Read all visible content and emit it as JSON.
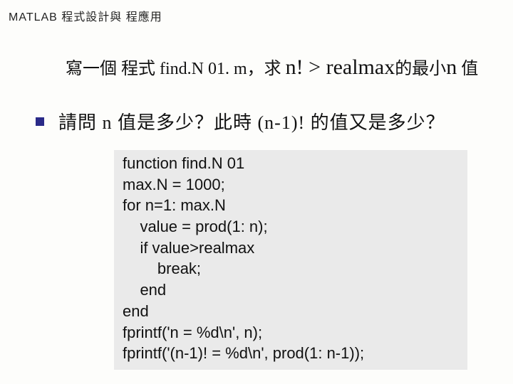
{
  "header": "MATLAB 程式設計與 程應用",
  "line1": {
    "p1": "寫一個 程式 find.N 01. m，求 ",
    "big1": "n! > realmax",
    "p2": "的最小",
    "big2": "n",
    "p3": " 值"
  },
  "line2": "請問 n 值是多少？此時 (n-1)! 的值又是多少？",
  "code": "function find.N 01\nmax.N = 1000;\nfor n=1: max.N\n    value = prod(1: n);\n    if value>realmax\n        break;\n    end\nend\nfprintf('n = %d\\n', n);\nfprintf('(n-1)! = %d\\n', prod(1: n-1));"
}
